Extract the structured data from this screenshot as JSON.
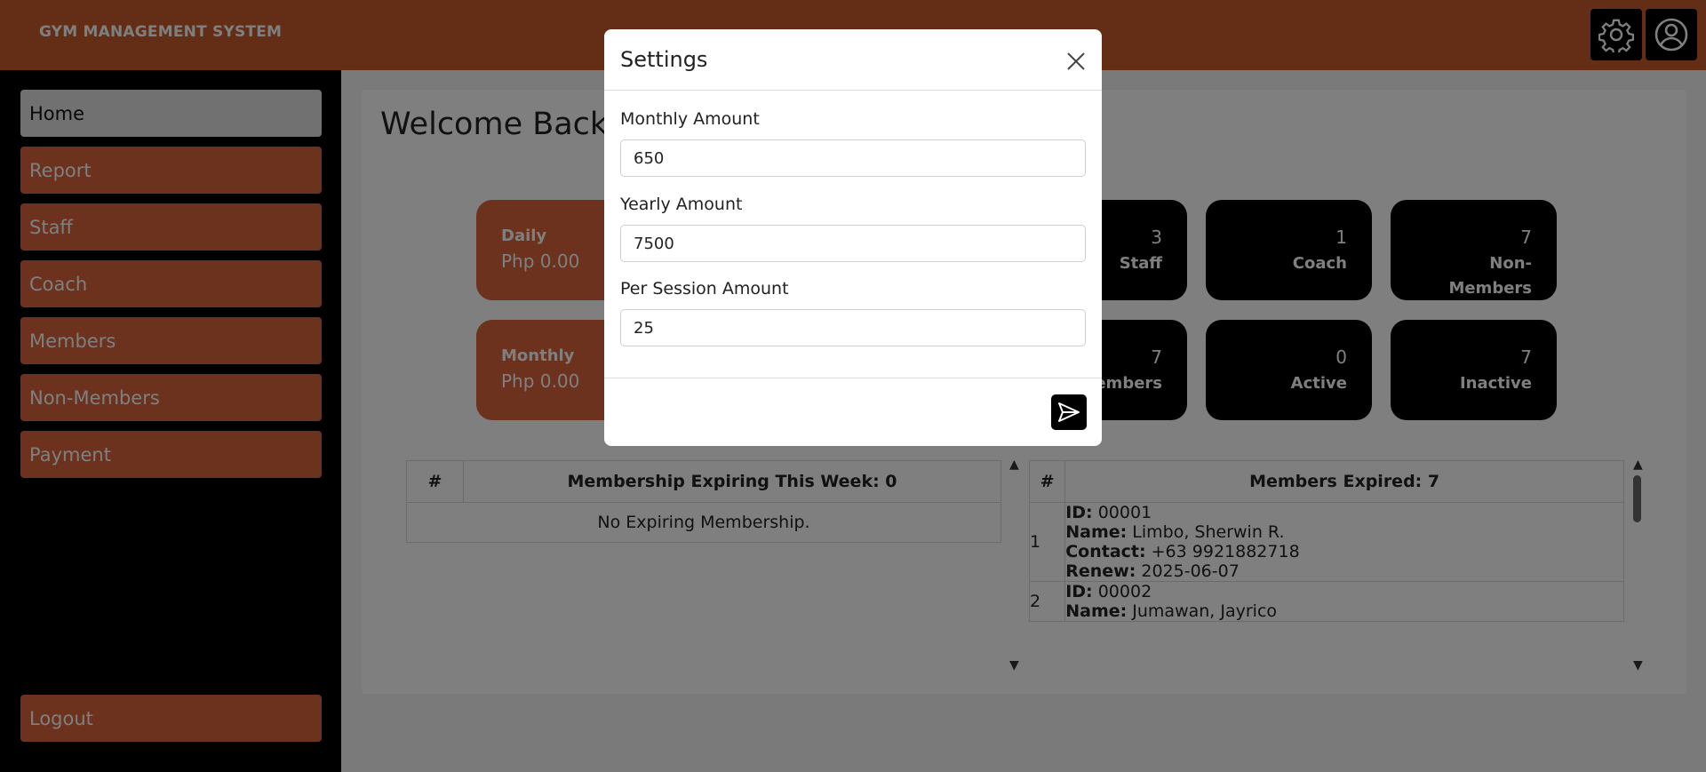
{
  "header": {
    "brand": "GYM MANAGEMENT SYSTEM",
    "settings_icon": "gear-icon",
    "profile_icon": "user-circle-icon"
  },
  "sidebar": {
    "items": [
      {
        "label": "Home",
        "active": true
      },
      {
        "label": "Report"
      },
      {
        "label": "Staff"
      },
      {
        "label": "Coach"
      },
      {
        "label": "Members"
      },
      {
        "label": "Non-Members"
      },
      {
        "label": "Payment"
      }
    ],
    "logout": "Logout"
  },
  "main": {
    "welcome": "Welcome Back, ",
    "cards": {
      "daily": {
        "label": "Daily",
        "amount": "Php 0.00"
      },
      "monthly": {
        "label": "Monthly",
        "amount": "Php 0.00"
      },
      "staff": {
        "count": "3",
        "label": "Staff"
      },
      "coach": {
        "count": "1",
        "label": "Coach"
      },
      "non_members": {
        "count": "7",
        "label": "Non-Members"
      },
      "members": {
        "count": "7",
        "label": "Members"
      },
      "active": {
        "count": "0",
        "label": "Active"
      },
      "inactive": {
        "count": "7",
        "label": "Inactive"
      }
    },
    "expiring_table": {
      "col_index": "#",
      "col_title": "Membership Expiring This Week: 0",
      "empty_text": "No Expiring Membership."
    },
    "expired_table": {
      "col_index": "#",
      "col_title": "Members Expired: 7",
      "rows": [
        {
          "idx": "1",
          "id_label": "ID:",
          "id": "00001",
          "name_label": "Name:",
          "name": "Limbo, Sherwin R.",
          "contact_label": "Contact:",
          "contact": "+63 9921882718",
          "renew_label": "Renew:",
          "renew": "2025-06-07"
        },
        {
          "idx": "2",
          "id_label": "ID:",
          "id": "00002",
          "name_label": "Name:",
          "name": "Jumawan, Jayrico"
        }
      ]
    }
  },
  "modal": {
    "title": "Settings",
    "monthly_label": "Monthly Amount",
    "monthly_value": "650",
    "yearly_label": "Yearly Amount",
    "yearly_value": "7500",
    "session_label": "Per Session Amount",
    "session_value": "25",
    "close_icon": "close-icon",
    "submit_icon": "send-icon"
  },
  "colors": {
    "header": "#c85a2a",
    "nav": "#d8643a",
    "sidebar_bg": "#000000",
    "card_dark": "#000000"
  }
}
